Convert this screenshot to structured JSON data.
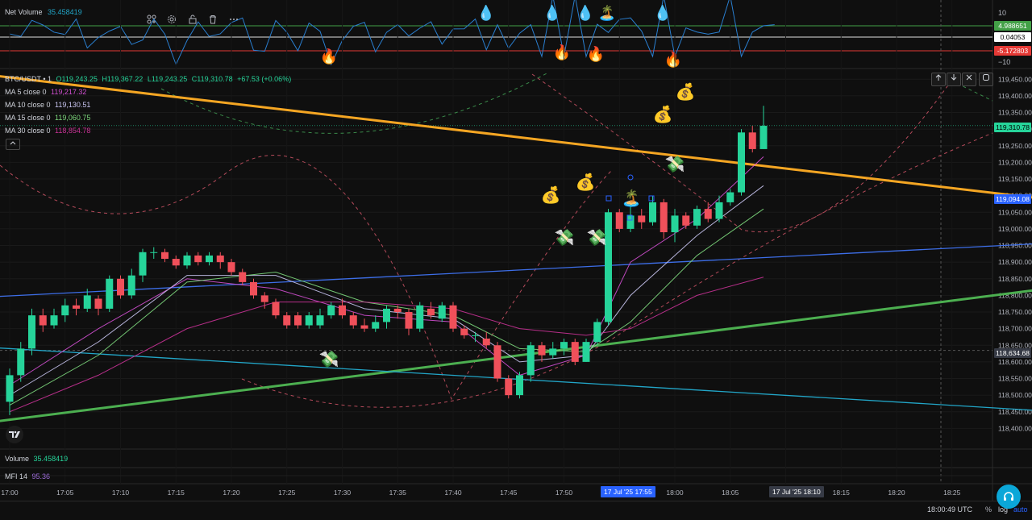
{
  "indicator_pane": {
    "name": "Net Volume",
    "value": "35.458419",
    "toolbar_icons": [
      "indicators-icon",
      "settings-icon",
      "lock-icon",
      "trash-icon",
      "more-icon"
    ],
    "scale_labels": [
      "10",
      "−10"
    ],
    "tags": {
      "top": "4.988651",
      "mid": "0.04053",
      "low": "-5.172803"
    }
  },
  "legend": {
    "symbol": "BTC/USDT • 1",
    "o": "O119,243.25",
    "h": "H119,367.22",
    "l": "L119,243.25",
    "c": "C119,310.78",
    "chg": "+67.53 (+0.06%)",
    "ma": [
      {
        "name": "MA 5 close 0",
        "value": "119,217.32",
        "color": "#d04fd0"
      },
      {
        "name": "MA 10 close 0",
        "value": "119,130.51",
        "color": "#c8c4f0"
      },
      {
        "name": "MA 15 close 0",
        "value": "119,060.75",
        "color": "#7dd87d"
      },
      {
        "name": "MA 30 close 0",
        "value": "118,854.78",
        "color": "#c83296"
      }
    ]
  },
  "bottom": {
    "volume_label": "Volume",
    "volume_value": "35.458419",
    "mfi_label": "MFI 14",
    "mfi_value": "95.36",
    "time_utc": "18:00:49 UTC",
    "percent": "%",
    "log": "log",
    "auto": "auto"
  },
  "price_tags": {
    "last": "119,310.78",
    "blue_line": "119,094.08",
    "crosshair": "118,634.68"
  },
  "time_tags": {
    "current": "17 Jul '25   17:55",
    "crosshair": "17 Jul '25   18:10"
  },
  "colors": {
    "up": "#26d49a",
    "down": "#f0505a",
    "bg": "#0f0f0f",
    "orange": "#f5a623",
    "green_line": "#4caf50",
    "blue_line": "#3d6ee8",
    "cyan_line": "#22a6c8"
  },
  "chart_data": {
    "type": "candlestick",
    "x_tick_labels": [
      "17:00",
      "17:05",
      "17:10",
      "17:15",
      "17:20",
      "17:25",
      "17:30",
      "17:35",
      "17:40",
      "17:45",
      "17:50",
      "17:55",
      "18:00",
      "18:05",
      "18:10",
      "18:15",
      "18:20",
      "18:25"
    ],
    "y_tick_labels": [
      "119,450.00",
      "119,400.00",
      "119,350.00",
      "119,300.00",
      "119,250.00",
      "119,200.00",
      "119,150.00",
      "119,100.00",
      "119,050.00",
      "119,000.00",
      "118,950.00",
      "118,900.00",
      "118,850.00",
      "118,800.00",
      "118,750.00",
      "118,700.00",
      "118,650.00",
      "118,600.00",
      "118,550.00",
      "118,500.00",
      "118,450.00",
      "118,400.00"
    ],
    "ylim": [
      118350,
      119475
    ],
    "candles": [
      [
        118480,
        118560,
        118440,
        118580
      ],
      [
        118560,
        118640,
        118540,
        118660
      ],
      [
        118640,
        118740,
        118620,
        118760
      ],
      [
        118740,
        118710,
        118690,
        118760
      ],
      [
        118710,
        118740,
        118700,
        118760
      ],
      [
        118740,
        118770,
        118720,
        118790
      ],
      [
        118770,
        118760,
        118740,
        118790
      ],
      [
        118760,
        118800,
        118750,
        118820
      ],
      [
        118790,
        118760,
        118740,
        118800
      ],
      [
        118760,
        118850,
        118750,
        118860
      ],
      [
        118850,
        118800,
        118790,
        118860
      ],
      [
        118800,
        118860,
        118790,
        118880
      ],
      [
        118860,
        118930,
        118840,
        118940
      ],
      [
        118930,
        118930,
        118910,
        118945
      ],
      [
        118930,
        118910,
        118900,
        118940
      ],
      [
        118910,
        118890,
        118880,
        118920
      ],
      [
        118890,
        118920,
        118880,
        118930
      ],
      [
        118920,
        118900,
        118890,
        118930
      ],
      [
        118900,
        118920,
        118890,
        118930
      ],
      [
        118920,
        118900,
        118880,
        118930
      ],
      [
        118900,
        118870,
        118860,
        118910
      ],
      [
        118870,
        118840,
        118830,
        118880
      ],
      [
        118840,
        118800,
        118790,
        118850
      ],
      [
        118800,
        118780,
        118760,
        118810
      ],
      [
        118780,
        118740,
        118730,
        118790
      ],
      [
        118740,
        118710,
        118700,
        118750
      ],
      [
        118740,
        118710,
        118700,
        118750
      ],
      [
        118710,
        118740,
        118700,
        118750
      ],
      [
        118710,
        118740,
        118700,
        118760
      ],
      [
        118740,
        118770,
        118730,
        118780
      ],
      [
        118770,
        118740,
        118730,
        118790
      ],
      [
        118740,
        118710,
        118700,
        118750
      ],
      [
        118710,
        118700,
        118690,
        118730
      ],
      [
        118700,
        118720,
        118690,
        118740
      ],
      [
        118720,
        118760,
        118700,
        118770
      ],
      [
        118760,
        118750,
        118730,
        118770
      ],
      [
        118750,
        118700,
        118680,
        118760
      ],
      [
        118700,
        118770,
        118690,
        118780
      ],
      [
        118760,
        118740,
        118730,
        118780
      ],
      [
        118730,
        118770,
        118720,
        118780
      ],
      [
        118770,
        118700,
        118690,
        118780
      ],
      [
        118700,
        118680,
        118670,
        118710
      ],
      [
        118680,
        118680,
        118660,
        118690
      ],
      [
        118670,
        118650,
        118640,
        118690
      ],
      [
        118650,
        118550,
        118540,
        118660
      ],
      [
        118550,
        118500,
        118490,
        118560
      ],
      [
        118500,
        118560,
        118490,
        118570
      ],
      [
        118560,
        118650,
        118540,
        118660
      ],
      [
        118650,
        118620,
        118600,
        118660
      ],
      [
        118620,
        118640,
        118610,
        118660
      ],
      [
        118640,
        118660,
        118620,
        118670
      ],
      [
        118660,
        118600,
        118590,
        118670
      ],
      [
        118600,
        118660,
        118600,
        118670
      ],
      [
        118660,
        118720,
        118650,
        118730
      ],
      [
        118720,
        119050,
        118710,
        119060
      ],
      [
        119050,
        119000,
        118990,
        119060
      ],
      [
        119000,
        119040,
        118990,
        119070
      ],
      [
        119040,
        119020,
        119000,
        119060
      ],
      [
        119020,
        119080,
        119010,
        119100
      ],
      [
        119080,
        118990,
        118970,
        119090
      ],
      [
        118990,
        119040,
        118960,
        119060
      ],
      [
        119040,
        119010,
        119000,
        119050
      ],
      [
        119010,
        119060,
        119000,
        119070
      ],
      [
        119060,
        119030,
        119020,
        119080
      ],
      [
        119030,
        119080,
        119020,
        119100
      ],
      [
        119080,
        119110,
        119070,
        119120
      ],
      [
        119110,
        119290,
        119100,
        119300
      ],
      [
        119290,
        119240,
        119230,
        119310
      ],
      [
        119240,
        119310,
        119240,
        119370
      ]
    ],
    "ma_lines": [
      {
        "name": "MA 5 close 0",
        "color": "#d04fd0",
        "points": [
          [
            0,
            118530
          ],
          [
            8,
            118700
          ],
          [
            16,
            118850
          ],
          [
            24,
            118820
          ],
          [
            32,
            118740
          ],
          [
            40,
            118720
          ],
          [
            46,
            118560
          ],
          [
            52,
            118620
          ],
          [
            56,
            118900
          ],
          [
            62,
            119030
          ],
          [
            68,
            119217
          ]
        ]
      },
      {
        "name": "MA 10 close 0",
        "color": "#c8c4f0",
        "points": [
          [
            0,
            118500
          ],
          [
            8,
            118660
          ],
          [
            16,
            118860
          ],
          [
            24,
            118860
          ],
          [
            32,
            118760
          ],
          [
            40,
            118730
          ],
          [
            46,
            118600
          ],
          [
            52,
            118620
          ],
          [
            56,
            118800
          ],
          [
            62,
            118980
          ],
          [
            68,
            119130
          ]
        ]
      },
      {
        "name": "MA 15 close 0",
        "color": "#7dd87d",
        "points": [
          [
            0,
            118470
          ],
          [
            8,
            118620
          ],
          [
            16,
            118840
          ],
          [
            24,
            118870
          ],
          [
            32,
            118780
          ],
          [
            40,
            118740
          ],
          [
            46,
            118640
          ],
          [
            52,
            118630
          ],
          [
            56,
            118720
          ],
          [
            62,
            118920
          ],
          [
            68,
            119060
          ]
        ]
      },
      {
        "name": "MA 30 close 0",
        "color": "#c83296",
        "points": [
          [
            0,
            118450
          ],
          [
            8,
            118560
          ],
          [
            16,
            118700
          ],
          [
            24,
            118780
          ],
          [
            32,
            118780
          ],
          [
            40,
            118760
          ],
          [
            46,
            118700
          ],
          [
            52,
            118680
          ],
          [
            56,
            118700
          ],
          [
            62,
            118800
          ],
          [
            68,
            118855
          ]
        ]
      }
    ],
    "trend_lines": [
      {
        "name": "orange",
        "color": "#f5a623",
        "from": [
          -5,
          119475
        ],
        "to": [
          122,
          118978
        ]
      },
      {
        "name": "green",
        "color": "#4caf50",
        "from": [
          -5,
          118405
        ],
        "to": [
          122,
          118940
        ]
      },
      {
        "name": "blue",
        "color": "#3d6ee8",
        "from": [
          -5,
          118790
        ],
        "to": [
          122,
          119005
        ]
      },
      {
        "name": "cyan",
        "color": "#22a6c8",
        "from": [
          -5,
          118650
        ],
        "to": [
          122,
          118395
        ]
      }
    ]
  }
}
